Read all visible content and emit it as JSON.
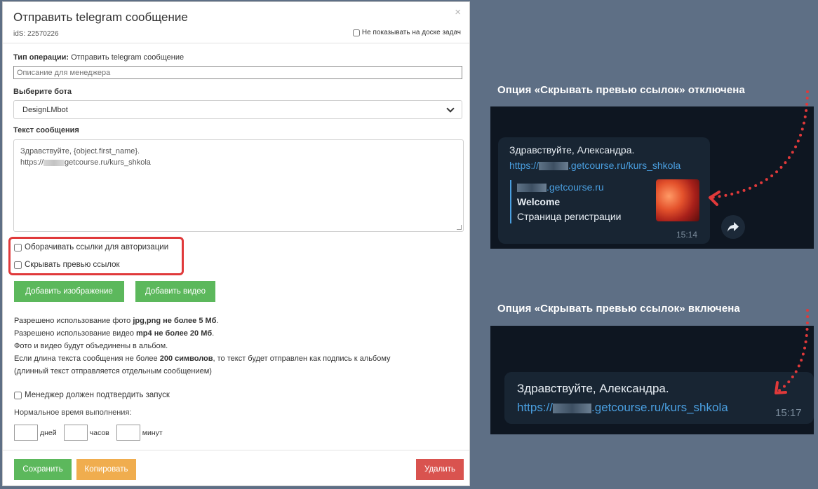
{
  "modal": {
    "title": "Отправить telegram сообщение",
    "close_icon": "×",
    "ids": "idS: 22570226",
    "hide_board_label": "Не показывать на доске задач",
    "op_type_label": "Тип операции:",
    "op_type_value": "Отправить telegram сообщение",
    "description_placeholder": "Описание для менеджера",
    "bot_label": "Выберите бота",
    "bot_selected": "DesignLMbot",
    "message_label": "Текст сообщения",
    "message_line1": "Здравствуйте, {object.first_name}.",
    "message_line2_prefix": "https://",
    "message_line2_suffix": "getcourse.ru/kurs_shkola",
    "checkbox_wrap_links": "Оборачивать ссылки для авторизации",
    "checkbox_hide_preview": "Скрывать превью ссылок",
    "add_image_button": "Добавить изображение",
    "add_video_button": "Добавить видео",
    "info": {
      "line1_prefix": "Разрешено использование фото ",
      "line1_bold": "jpg,png не более 5 Мб",
      "line1_suffix": ".",
      "line2_prefix": "Разрешено использование видео ",
      "line2_bold": "mp4 не более 20 Мб",
      "line2_suffix": ".",
      "line3": "Фото и видео будут объединены в альбом.",
      "line4_prefix": "Если длина текста сообщения не более ",
      "line4_bold": "200 символов",
      "line4_suffix": ", то текст будет отправлен как подпись к альбому",
      "line5": "(длинный текст отправляется отдельным сообщением)"
    },
    "checkbox_manager_confirm": "Менеджер должен подтвердить запуск",
    "normal_time_label": "Нормальное время выполнения:",
    "unit_days": "дней",
    "unit_hours": "часов",
    "unit_minutes": "минут",
    "save_button": "Сохранить",
    "copy_button": "Копировать",
    "delete_button": "Удалить"
  },
  "right": {
    "caption_off": "Опция «Скрывать превью ссылок» отключена",
    "caption_on": "Опция «Скрывать превью ссылок» включена",
    "greeting": "Здравствуйте, Александра.",
    "link_prefix": "https://",
    "link_suffix": ".getcourse.ru/kurs_shkola",
    "preview_site": ".getcourse.ru",
    "preview_title": "Welcome",
    "preview_desc": "Страница регистрации",
    "time1": "15:14",
    "time2": "15:17",
    "share_icon": "share-arrow-icon"
  },
  "colors": {
    "background": "#5e6f85",
    "green": "#5cb85c",
    "orange": "#f0ad4e",
    "red": "#d9534f",
    "highlight": "#e0393a",
    "tg_bg": "#0e1621",
    "tg_bubble": "#182533",
    "tg_link": "#4a9fe0"
  }
}
